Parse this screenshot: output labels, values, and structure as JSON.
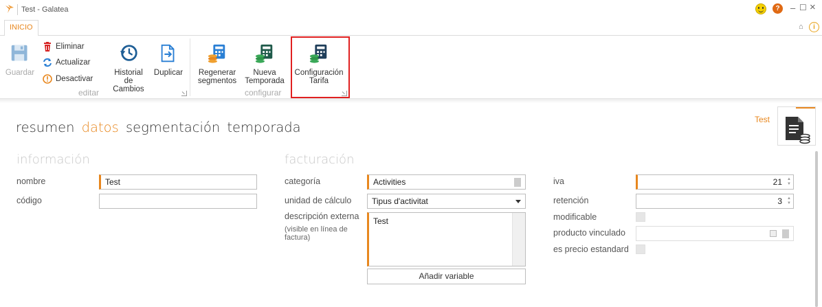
{
  "window": {
    "title": "Test - Galatea",
    "controls": {
      "minimize": "–",
      "maximize": "☐",
      "close": "×"
    },
    "help": "?"
  },
  "tabs": {
    "active": "INICIO"
  },
  "ribbon": {
    "editar": {
      "label": "editar",
      "guardar": "Guardar",
      "eliminar": "Eliminar",
      "actualizar": "Actualizar",
      "desactivar": "Desactivar",
      "historial": [
        "Historial",
        "de Cambios"
      ],
      "duplicar": "Duplicar"
    },
    "configurar": {
      "label": "configurar",
      "regenerar": [
        "Regenerar",
        "segmentos"
      ],
      "nueva": [
        "Nueva",
        "Temporada"
      ],
      "configuracion": [
        "Configuración",
        "Tarifa"
      ]
    }
  },
  "nav": {
    "items": [
      "resumen",
      "datos",
      "segmentación",
      "temporada"
    ],
    "active": "datos"
  },
  "record": {
    "name": "Test"
  },
  "informacion": {
    "title": "información",
    "nombre_label": "nombre",
    "nombre_value": "Test",
    "codigo_label": "código",
    "codigo_value": ""
  },
  "facturacion": {
    "title": "facturación",
    "categoria_label": "categoría",
    "categoria_value": "Activities",
    "unidad_label": "unidad de cálculo",
    "unidad_value": "Tipus d'activitat",
    "descripcion_label": "descripción externa",
    "descripcion_sublabel": "(visible en línea de factura)",
    "descripcion_value": "Test",
    "add_variable": "Añadir variable"
  },
  "impuestos": {
    "iva_label": "iva",
    "iva_value": "21",
    "retencion_label": "retención",
    "retencion_value": "3",
    "modificable_label": "modificable",
    "producto_label": "producto vinculado",
    "producto_value": "",
    "precio_label": "es precio estandard"
  },
  "colors": {
    "accent": "#e8871e",
    "highlight": "#e02020"
  }
}
